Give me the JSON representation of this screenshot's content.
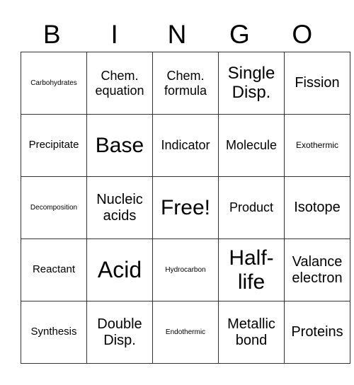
{
  "header": {
    "letters": [
      "B",
      "I",
      "N",
      "G",
      "O"
    ]
  },
  "grid": {
    "rows": [
      [
        "Carbohydrates",
        "Chem.\nequation",
        "Chem.\nformula",
        "Single\nDisp.",
        "Fission"
      ],
      [
        "Precipitate",
        "Base",
        "Indicator",
        "Molecule",
        "Exothermic"
      ],
      [
        "Decomposition",
        "Nucleic\nacids",
        "Free!",
        "Product",
        "Isotope"
      ],
      [
        "Reactant",
        "Acid",
        "Hydrocarbon",
        "Half-\nlife",
        "Valance\nelectron"
      ],
      [
        "Synthesis",
        "Double\nDisp.",
        "Endothermic",
        "Metallic\nbond",
        "Proteins"
      ]
    ]
  }
}
